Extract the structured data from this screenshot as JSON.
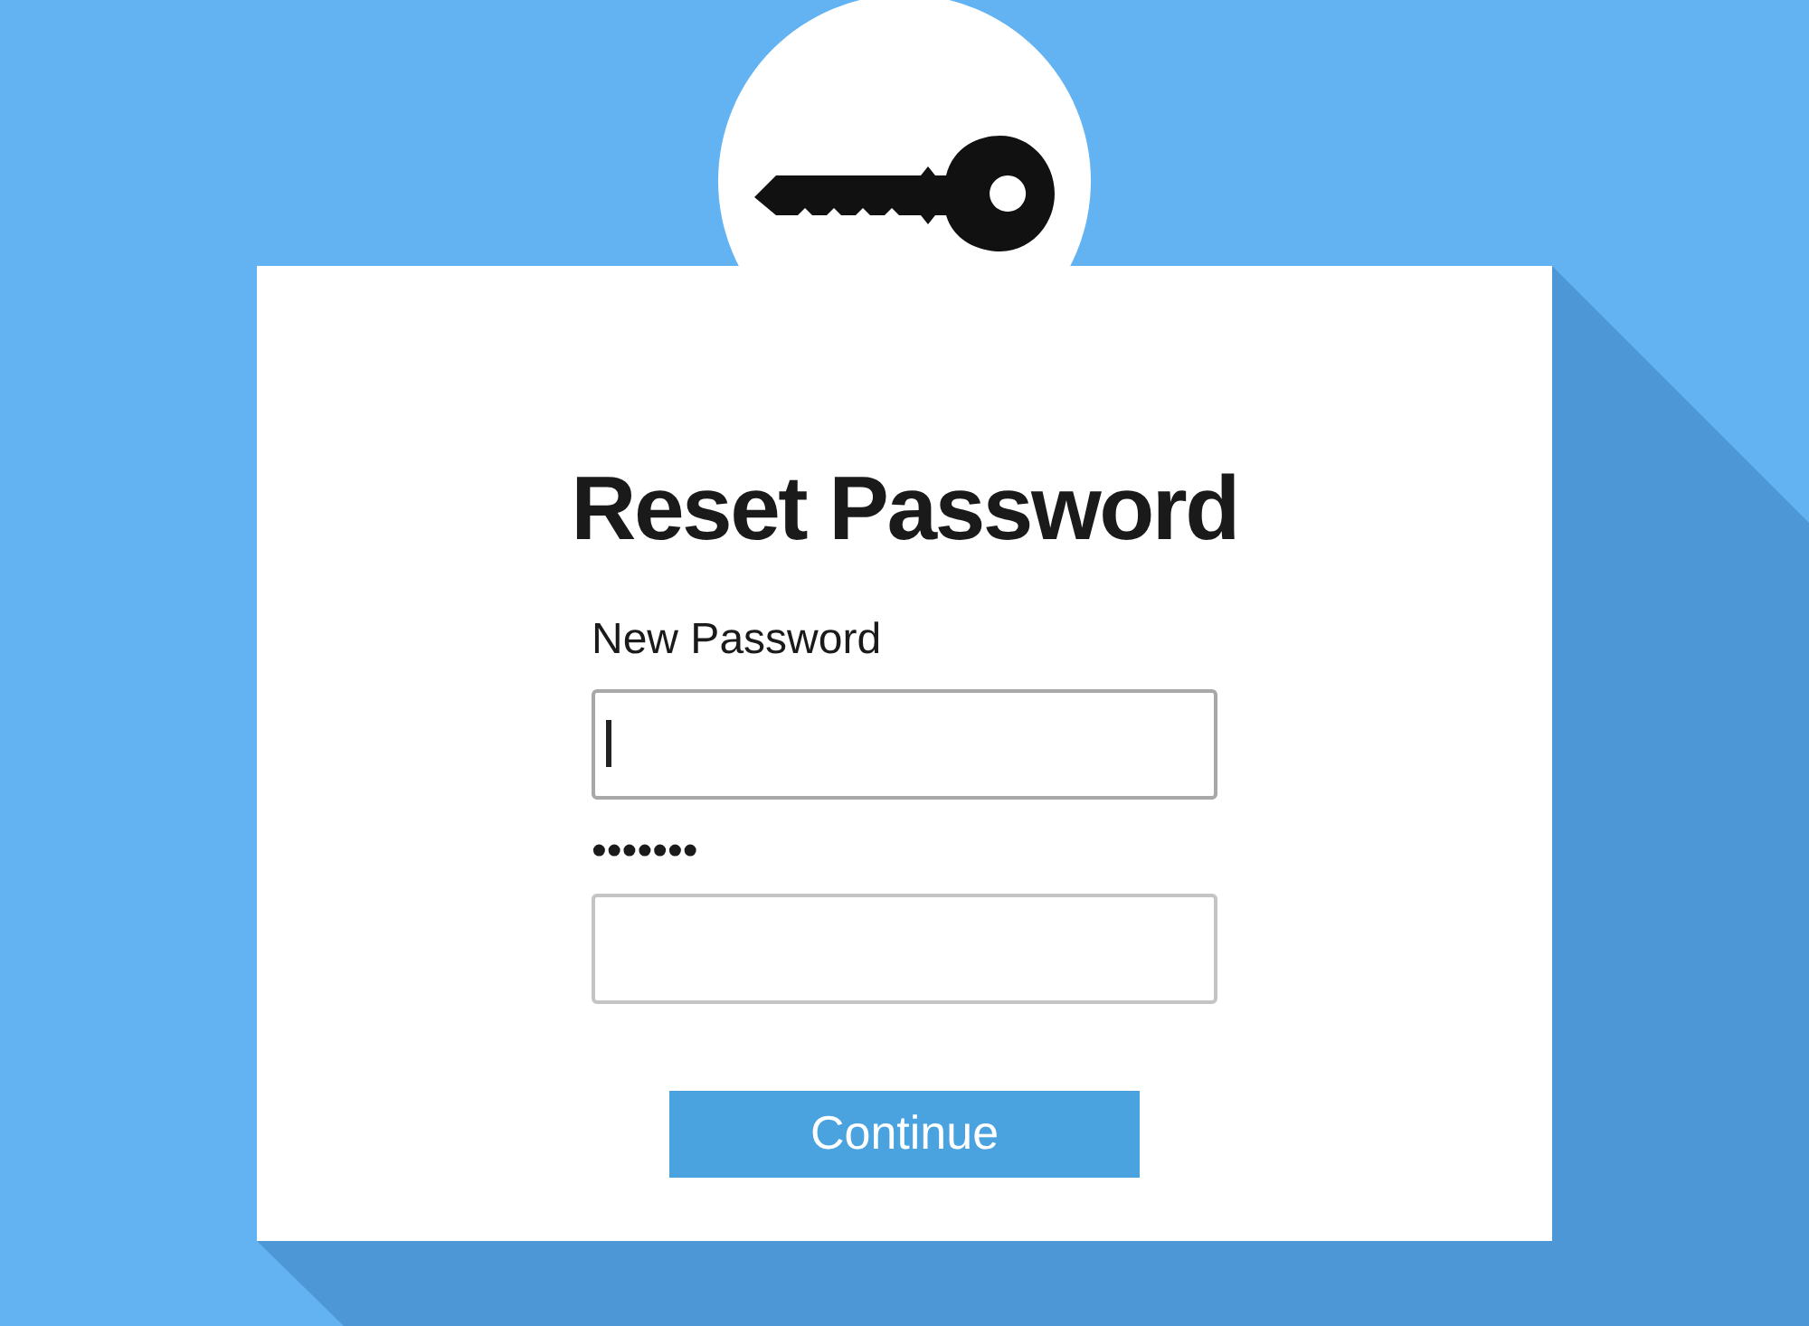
{
  "title": "Reset Password",
  "fields": [
    {
      "label": "New Password",
      "focused": true
    },
    {
      "label": "•••••••",
      "focused": false
    }
  ],
  "button": "Continue"
}
